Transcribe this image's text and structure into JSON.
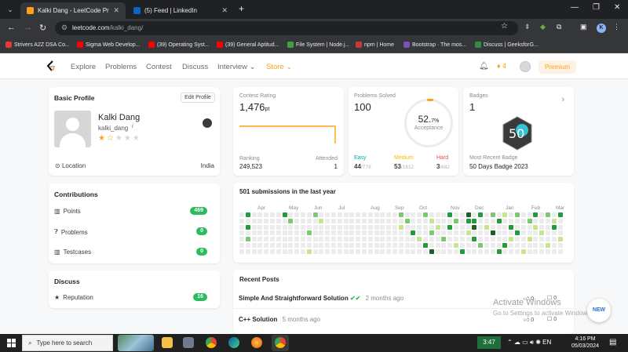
{
  "browser": {
    "tabs": [
      {
        "title": "Kalki Dang - LeetCode Profile",
        "active": true
      },
      {
        "title": "(5) Feed | LinkedIn",
        "active": false
      }
    ],
    "url_host": "leetcode.com",
    "url_path": "/kalki_dang/",
    "profile_initial": "K",
    "bookmarks": [
      "Strivers A2Z DSA Co...",
      "Sigma Web Develop...",
      "(39) Operating Syst...",
      "(39) General Aptitud...",
      "File System | Node.j...",
      "npm | Home",
      "Bootstrap · The mos...",
      "Discuss | GeeksforG..."
    ]
  },
  "nav": {
    "links": [
      "Explore",
      "Problems",
      "Contest",
      "Discuss",
      "Interview",
      "Store"
    ],
    "streak": "4",
    "premium": "Premium"
  },
  "profile": {
    "section_title": "Basic Profile",
    "edit_label": "Edit Profile",
    "name": "Kalki Dang",
    "username": "kalki_dang",
    "info_mark": "i",
    "rating_stars": "1.5",
    "location_label": "Location",
    "location_value": "India"
  },
  "contributions": {
    "title": "Contributions",
    "items": [
      {
        "label": "Points",
        "value": "469"
      },
      {
        "label": "Problems",
        "value": "0"
      },
      {
        "label": "Testcases",
        "value": "0"
      }
    ]
  },
  "discuss": {
    "title": "Discuss",
    "items": [
      {
        "label": "Reputation",
        "value": "16"
      }
    ]
  },
  "contest": {
    "title": "Contest Rating",
    "rating": "1,476",
    "unit": "pt",
    "ranking_label": "Ranking",
    "ranking": "249,523",
    "attended_label": "Attended",
    "attended": "1"
  },
  "solved": {
    "title": "Problems Solved",
    "total": "100",
    "acceptance": "52.",
    "acceptance_dec": "7%",
    "acceptance_label": "Acceptance",
    "easy_label": "Easy",
    "easy": "44",
    "easy_total": "/778",
    "medium_label": "Medium",
    "medium": "53",
    "medium_total": "/1612",
    "hard_label": "Hard",
    "hard": "3",
    "hard_total": "/682",
    "colors": {
      "easy": "#00af9b",
      "medium": "#ffb800",
      "hard": "#ef4743"
    }
  },
  "badges": {
    "title": "Badges",
    "count": "1",
    "recent_label": "Most Recent Badge",
    "recent_name": "50 Days Badge 2023",
    "badge_mark": "50"
  },
  "activity": {
    "title": "501 submissions in the last year",
    "months": [
      "Apr",
      "May",
      "Jun",
      "Jul",
      "Aug",
      "Sep",
      "Oct",
      "Nov",
      "Dec",
      "Jan",
      "Feb",
      "Mar"
    ]
  },
  "posts": {
    "title": "Recent Posts",
    "items": [
      {
        "title": "Simple And Straightforward Solution",
        "time": "2 months ago",
        "likes": "0",
        "comments": "0"
      },
      {
        "title": "C++ Solution",
        "time": "5 months ago",
        "likes": "0",
        "comments": "0"
      }
    ]
  },
  "overlay": {
    "activate_title": "Activate Windows",
    "activate_sub": "Go to Settings to activate Windows.",
    "new_button": "NEW"
  },
  "taskbar": {
    "search_placeholder": "Type here to search",
    "battery_time": "3:47",
    "time": "4:16 PM",
    "date": "05/03/2024"
  }
}
